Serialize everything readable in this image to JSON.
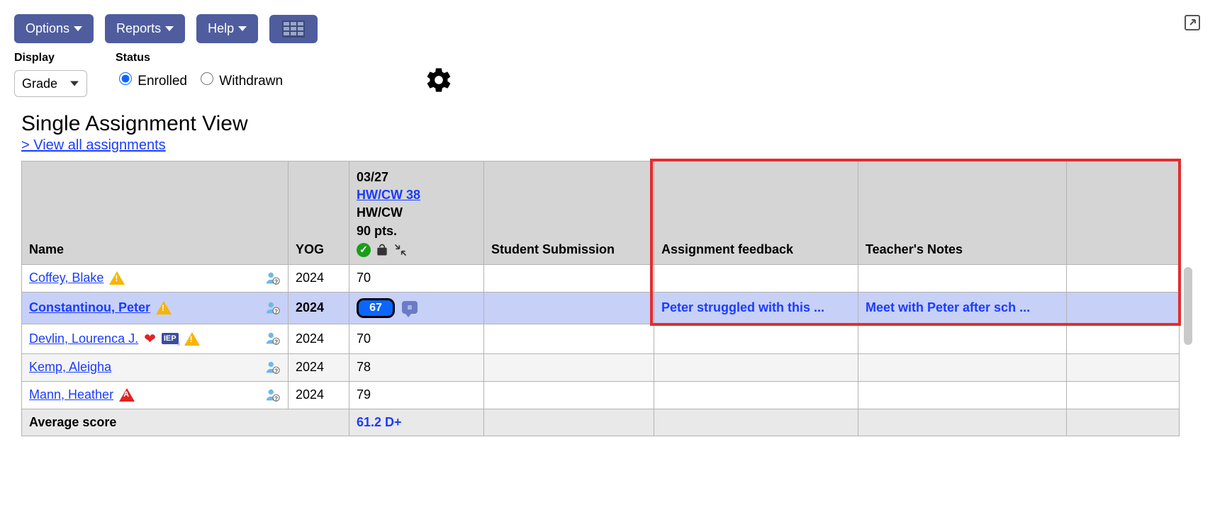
{
  "toolbar": {
    "options_label": "Options",
    "reports_label": "Reports",
    "help_label": "Help"
  },
  "filters": {
    "display_label": "Display",
    "display_value": "Grade",
    "status_label": "Status",
    "status_enrolled": "Enrolled",
    "status_withdrawn": "Withdrawn",
    "selected_status": "enrolled"
  },
  "view": {
    "title": "Single Assignment View",
    "all_link": "> View all assignments"
  },
  "columns": {
    "name": "Name",
    "yog": "YOG",
    "submission": "Student Submission",
    "feedback": "Assignment feedback",
    "notes": "Teacher's Notes"
  },
  "assignment_header": {
    "date": "03/27",
    "link": "HW/CW 38",
    "category": "HW/CW",
    "points": "90 pts."
  },
  "rows": [
    {
      "name": "Coffey, Blake",
      "badges": [
        "warn"
      ],
      "yog": "2024",
      "score": "70",
      "editable": false,
      "feedback": "",
      "notes": "",
      "alt": false,
      "selected": false
    },
    {
      "name": "Constantinou, Peter",
      "badges": [
        "warn"
      ],
      "yog": "2024",
      "score": "67",
      "editable": true,
      "has_comment": true,
      "feedback": "Peter struggled with this ...",
      "notes": "Meet with Peter after sch ...",
      "alt": false,
      "selected": true
    },
    {
      "name": "Devlin, Lourenca J.",
      "badges": [
        "med",
        "iep",
        "warn"
      ],
      "yog": "2024",
      "score": "70",
      "editable": false,
      "feedback": "",
      "notes": "",
      "alt": false,
      "selected": false
    },
    {
      "name": "Kemp, Aleigha",
      "badges": [],
      "yog": "2024",
      "score": "78",
      "editable": false,
      "feedback": "",
      "notes": "",
      "alt": true,
      "selected": false
    },
    {
      "name": "Mann, Heather",
      "badges": [
        "absent"
      ],
      "yog": "2024",
      "score": "79",
      "editable": false,
      "feedback": "",
      "notes": "",
      "alt": false,
      "selected": false
    }
  ],
  "footer": {
    "label": "Average score",
    "value": "61.2 D+"
  }
}
